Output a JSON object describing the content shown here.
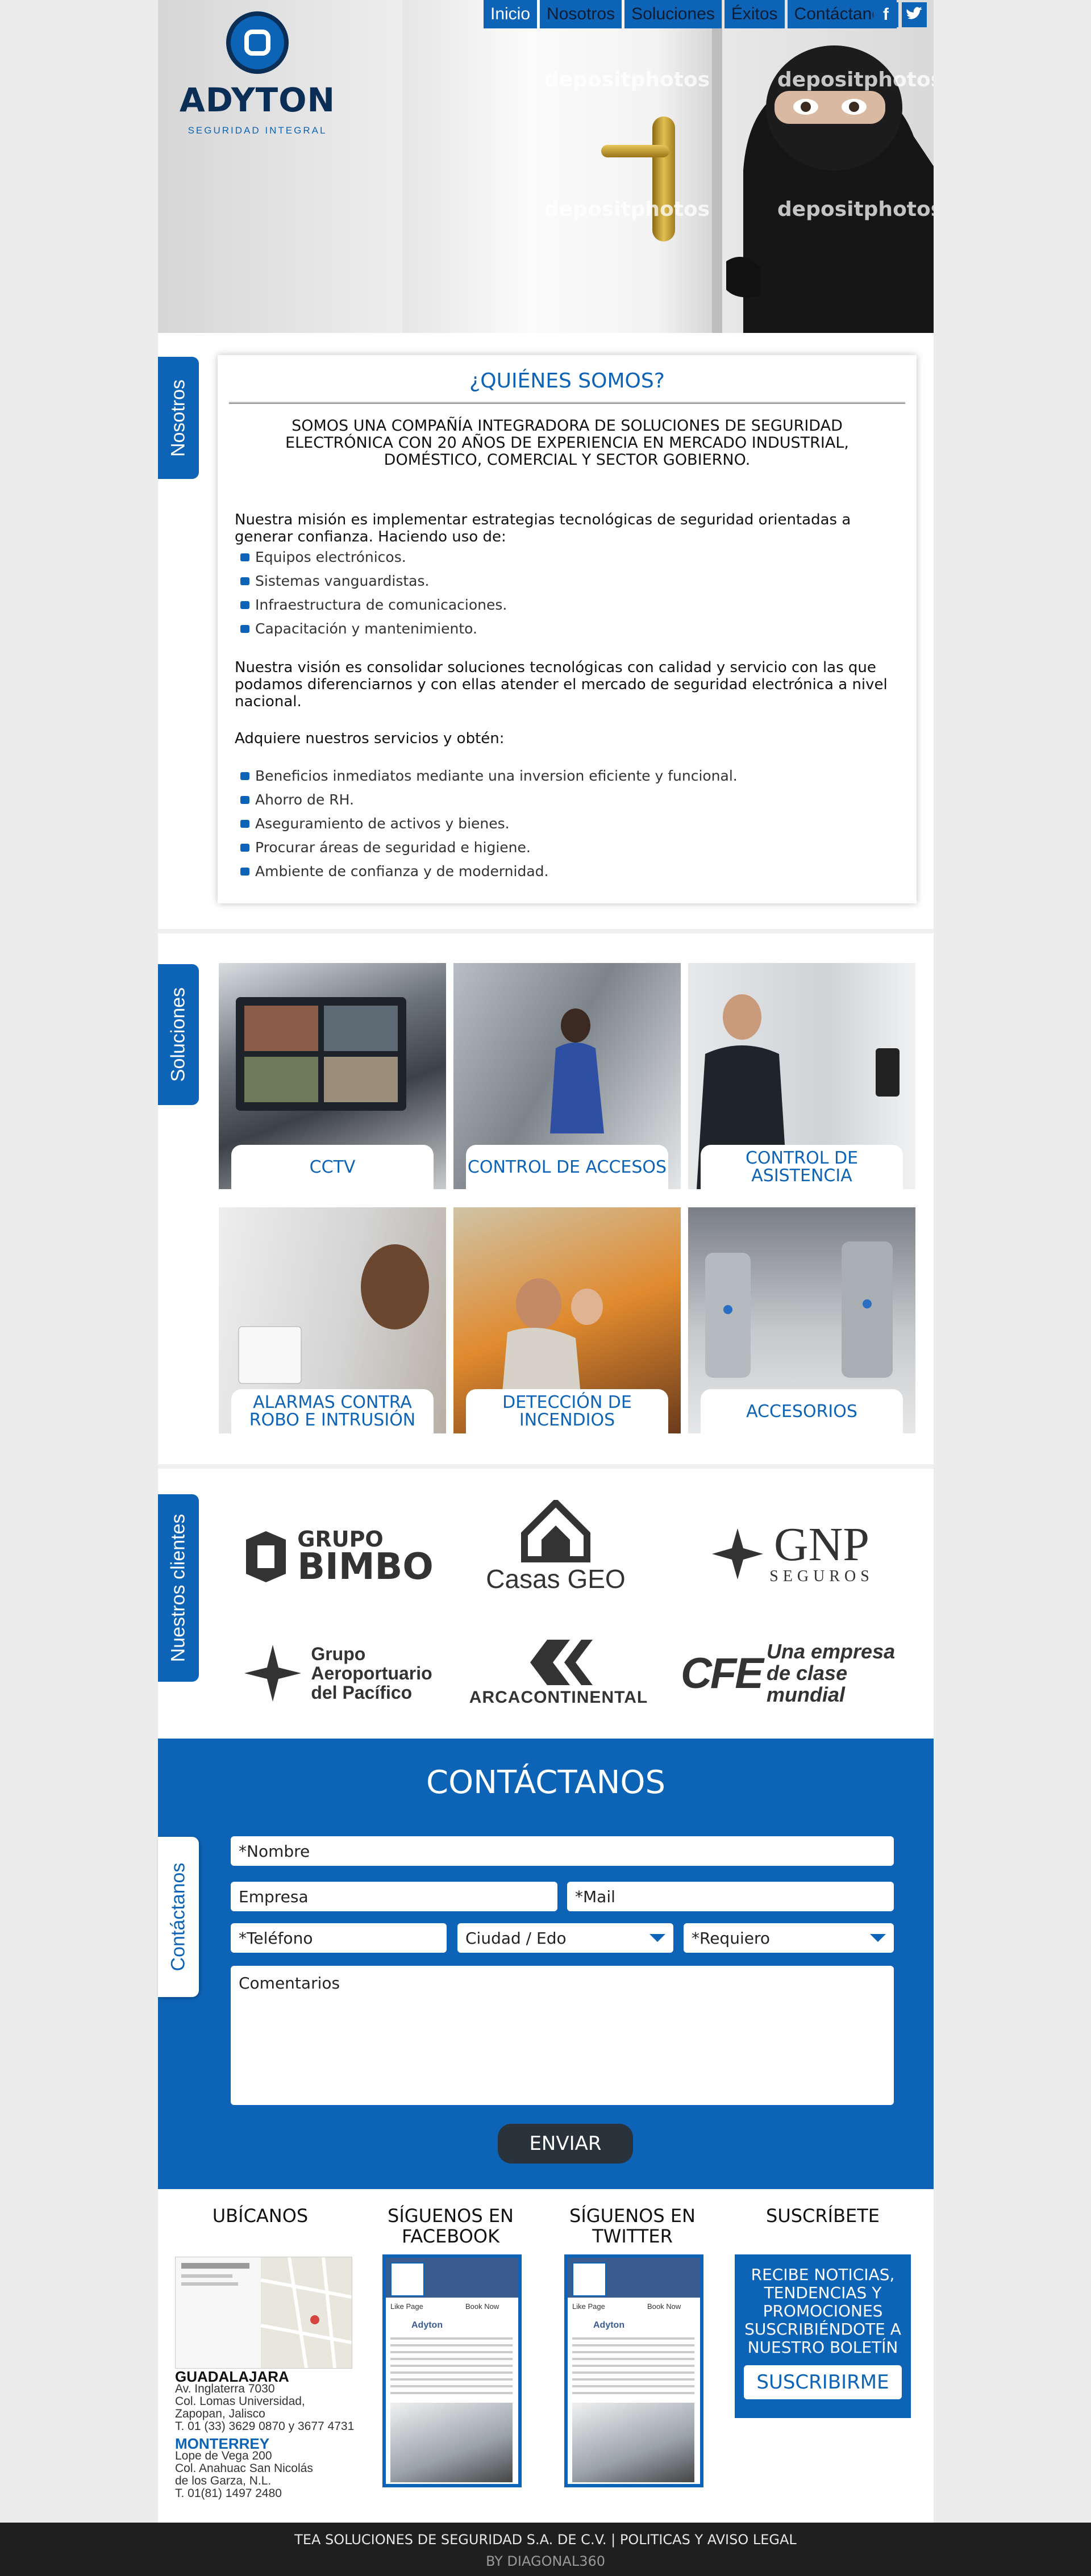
{
  "brand": {
    "name": "ADYTON",
    "tagline": "SEGURIDAD INTEGRAL",
    "primary_color": "#0d63b5",
    "dark_color": "#0b2e57"
  },
  "hero": {
    "watermark": "depositphotos"
  },
  "nav": {
    "items": [
      "Inicio",
      "Nosotros",
      "Soluciones",
      "Éxitos",
      "Contáctanos"
    ],
    "active": "Inicio"
  },
  "social": {
    "facebook": "f",
    "twitter": "t"
  },
  "about": {
    "tab": "Nosotros",
    "title": "¿QUIÉNES SOMOS?",
    "intro": "SOMOS UNA COMPAÑÍA INTEGRADORA DE SOLUCIONES DE SEGURIDAD ELECTRÓNICA CON 20 AÑOS DE EXPERIENCIA EN MERCADO INDUSTRIAL, DOMÉSTICO, COMERCIAL Y SECTOR GOBIERNO.",
    "mission": "Nuestra misión es implementar estrategias tecnológicas de seguridad orientadas a generar confianza. Haciendo uso de:",
    "mission_items": [
      "Equipos electrónicos.",
      "Sistemas vanguardistas.",
      "Infraestructura de comunicaciones.",
      "Capacitación y mantenimiento."
    ],
    "vision": "Nuestra visión es consolidar soluciones tecnológicas con calidad y servicio con las que podamos diferenciarnos y con ellas atender el mercado de seguridad electrónica a nivel nacional.",
    "benefits_intro": "Adquiere nuestros servicios y obtén:",
    "benefits": [
      "Beneficios inmediatos mediante una inversion eficiente y funcional.",
      "Ahorro de RH.",
      "Aseguramiento de activos y bienes.",
      "Procurar áreas de seguridad e higiene.",
      "Ambiente de confianza y de modernidad."
    ]
  },
  "solutions": {
    "tab": "Soluciones",
    "items": [
      {
        "label": "CCTV",
        "photo_color": "#7d8791"
      },
      {
        "label": "CONTROL DE ACCESOS",
        "photo_color": "#8d9196"
      },
      {
        "label": "CONTROL DE ASISTENCIA",
        "photo_color": "#c9ccce"
      },
      {
        "label": "ALARMAS CONTRA ROBO E INTRUSIÓN",
        "photo_color": "#d9dadb"
      },
      {
        "label": "DETECCIÓN DE INCENDIOS",
        "photo_color": "#c77a32"
      },
      {
        "label": "ACCESORIOS",
        "photo_color": "#9da2a7"
      }
    ]
  },
  "clients": {
    "tab": "Nuestros clientes",
    "logos": [
      {
        "top": "GRUPO",
        "bottom": "BIMBO"
      },
      {
        "name": "Casas GEO"
      },
      {
        "name": "GNP",
        "sub": "SEGUROS"
      },
      {
        "lines": [
          "Grupo",
          "Aeroportuario",
          "del Pacífico"
        ]
      },
      {
        "name": "ARCACONTINENTAL"
      },
      {
        "mark": "CFE",
        "slogan": [
          "Una empresa",
          "de clase mundial"
        ]
      }
    ]
  },
  "contact": {
    "tab": "Contáctanos",
    "title": "CONTÁCTANOS",
    "placeholders": {
      "name": "*Nombre",
      "company": "Empresa",
      "mail": "*Mail",
      "phone": "*Teléfono",
      "city": "Ciudad / Edo",
      "requires": "*Requiero",
      "comments": "Comentarios"
    },
    "submit": "ENVIAR"
  },
  "footer": {
    "locate_title": "UBÍCANOS",
    "facebook_title": "SÍGUENOS EN FACEBOOK",
    "twitter_title": "SÍGUENOS EN TWITTER",
    "subscribe_title": "SUSCRÍBETE",
    "gdl": {
      "city": "GUADALAJARA",
      "lines": [
        "Av. Inglaterra 7030",
        "Col. Lomas Universidad,",
        "Zapopan, Jalisco",
        "T. 01 (33) 3629 0870 y 3677 4731"
      ]
    },
    "mty": {
      "city": "MONTERREY",
      "lines": [
        "Lope de Vega 200",
        "Col. Anahuac San Nicolás",
        "de los Garza, N.L.",
        "T. 01(81) 1497 2480"
      ]
    },
    "widget": {
      "page": "Adyton",
      "like": "Like Page",
      "book": "Book Now"
    },
    "subscribe_text": "RECIBE NOTICIAS, TENDENCIAS Y PROMOCIONES SUSCRIBIÉNDOTE A NUESTRO BOLETÍN",
    "subscribe_button": "SUSCRIBIRME"
  },
  "bottom": {
    "legal": "TEA SOLUCIONES DE SEGURIDAD S.A. DE C.V. | POLITICAS Y AVISO LEGAL",
    "credit": "BY DIAGONAL360"
  }
}
